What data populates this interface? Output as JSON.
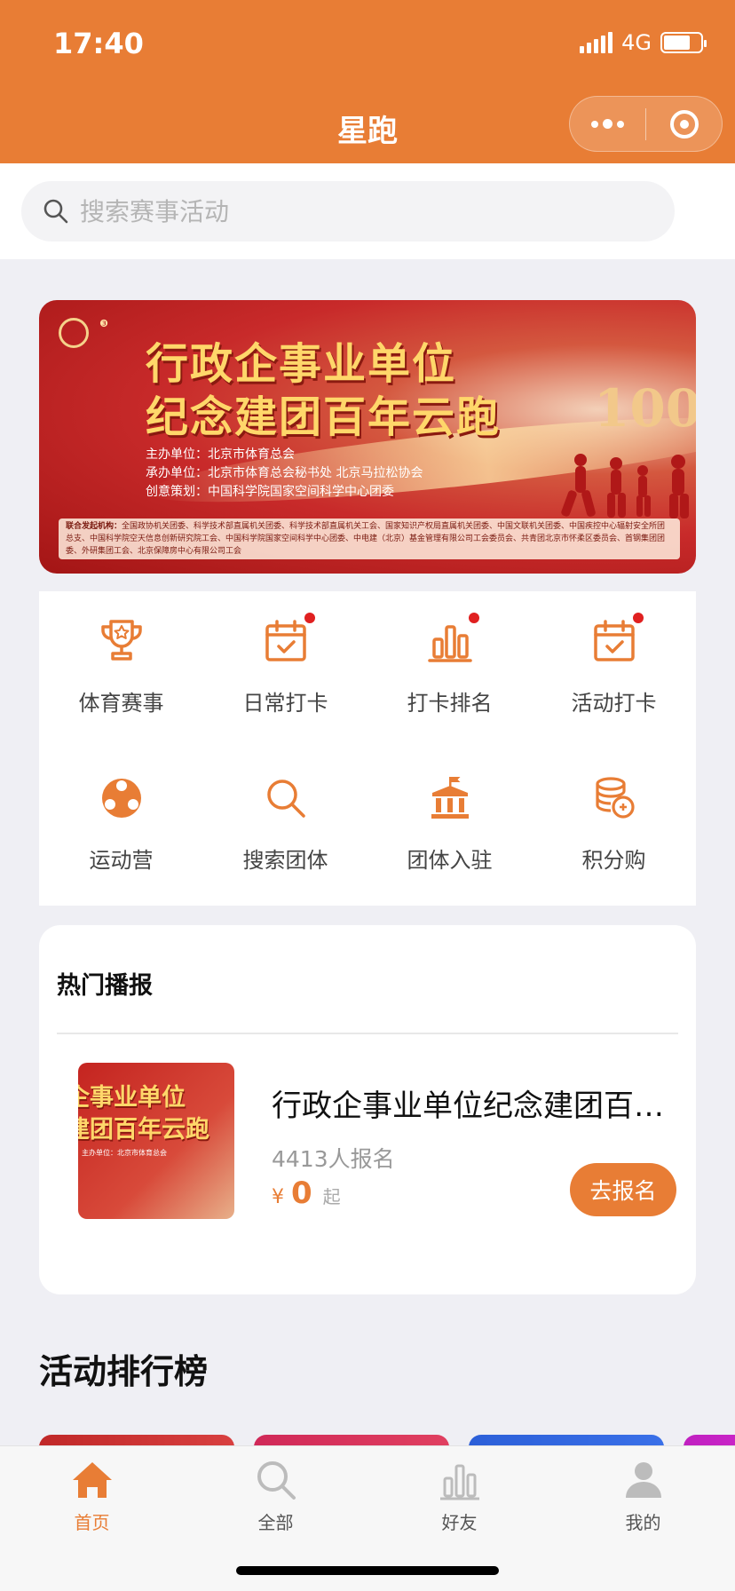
{
  "status_bar": {
    "time": "17:40",
    "network": "4G",
    "battery_level": 0.72
  },
  "nav": {
    "title": "星跑"
  },
  "search": {
    "placeholder": "搜索赛事活动"
  },
  "banner": {
    "title_line1": "行政企事业单位",
    "title_line2": "纪念建团百年云跑",
    "big_number": "100",
    "host": "主办单位：北京市体育总会",
    "organizer": "承办单位：北京市体育总会秘书处  北京马拉松协会",
    "planning": "创意策划：中国科学院国家空间科学中心团委",
    "partners_label": "联合发起机构：",
    "partners": "全国政协机关团委、科学技术部直属机关团委、科学技术部直属机关工会、国家知识产权局直属机关团委、中国文联机关团委、中国疾控中心辐射安全所团总支、中国科学院空天信息创新研究院工会、中国科学院国家空间科学中心团委、中电建（北京）基金管理有限公司工会委员会、共青团北京市怀柔区委员会、首钢集团团委、外研集团工会、北京保障房中心有限公司工会"
  },
  "grid_items": [
    {
      "label": "体育赛事",
      "icon": "trophy-icon",
      "badge": false
    },
    {
      "label": "日常打卡",
      "icon": "calendar-check-icon",
      "badge": true
    },
    {
      "label": "打卡排名",
      "icon": "bar-rank-icon",
      "badge": true
    },
    {
      "label": "活动打卡",
      "icon": "calendar-check-icon",
      "badge": true
    },
    {
      "label": "运动营",
      "icon": "camp-icon",
      "badge": false
    },
    {
      "label": "搜索团体",
      "icon": "search-icon",
      "badge": false
    },
    {
      "label": "团体入驻",
      "icon": "building-icon",
      "badge": false
    },
    {
      "label": "积分购",
      "icon": "coins-icon",
      "badge": false
    }
  ],
  "hot": {
    "section_title": "热门播报",
    "thumb_line1": "企事业单位",
    "thumb_line2": "建团百年云跑",
    "name": "行政企事业单位纪念建团百年云跑",
    "count_text": "4413人报名",
    "currency": "¥",
    "price": "0",
    "price_suffix": "起",
    "signup_label": "去报名"
  },
  "rank": {
    "title": "活动排行榜"
  },
  "tabs": [
    {
      "label": "首页",
      "icon": "home-icon",
      "active": true
    },
    {
      "label": "全部",
      "icon": "search-icon",
      "active": false
    },
    {
      "label": "好友",
      "icon": "bar-chart-icon",
      "active": false
    },
    {
      "label": "我的",
      "icon": "user-icon",
      "active": false
    }
  ],
  "colors": {
    "accent": "#e87d35",
    "badge": "#e02020",
    "background": "#efeff4"
  }
}
